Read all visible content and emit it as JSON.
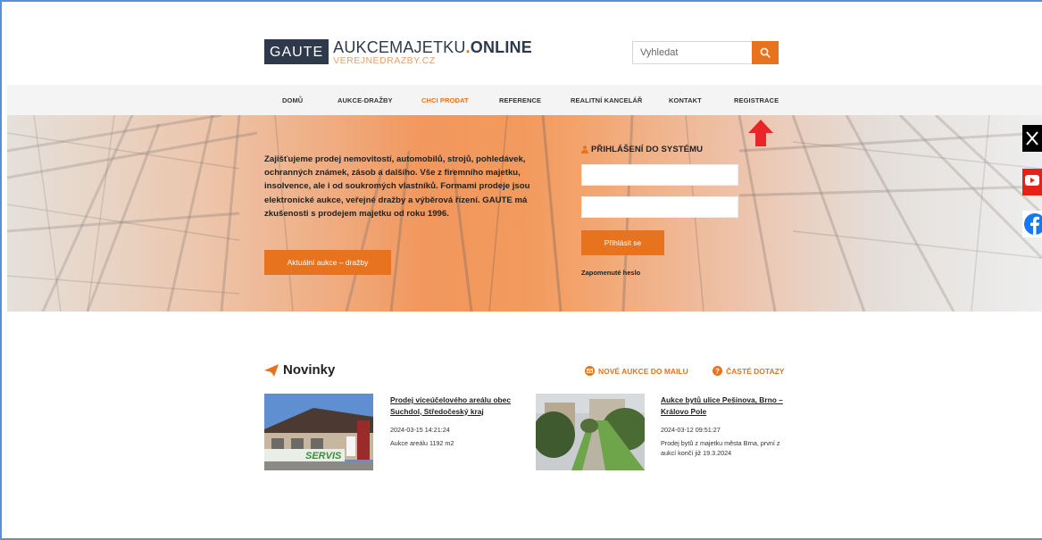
{
  "header": {
    "logo_box": "GAUTE",
    "logo_thin": "AUKCE",
    "logo_mid": "MAJETKU",
    "logo_dot": ".",
    "logo_bold": "ONLINE",
    "logo_sub": "VEREJNEDRAZBY.CZ",
    "search_placeholder": "Vyhledat"
  },
  "nav": {
    "items": [
      {
        "label": "DOMŮ"
      },
      {
        "label": "AUKCE-DRAŽBY"
      },
      {
        "label": "CHCI PRODAT"
      },
      {
        "label": "REFERENCE"
      },
      {
        "label": "REALITNÍ KANCELÁŘ"
      },
      {
        "label": "KONTAKT"
      },
      {
        "label": "REGISTRACE"
      }
    ],
    "active_color": "#e8731f"
  },
  "hero": {
    "text": "Zajišťujeme prodej nemovitostí, automobilů, strojů, pohledávek, ochranných známek, zásob a dalšího. Vše z firemního majetku, insolvence, ale i od soukromých vlastníků. Formami prodeje jsou elektronické aukce, veřejné dražby a výběrová řízení. GAUTE má zkušenosti s prodejem majetku od roku 1996.",
    "button": "Aktuální aukce – dražby"
  },
  "login": {
    "title": "PŘIHLÁŠENÍ DO SYSTÉMU",
    "button": "Přihlásit se",
    "forgot": "Zapomenuté heslo"
  },
  "news": {
    "title": "Novinky",
    "link_mail": "NOVÉ AUKCE DO MAILU",
    "link_faq": "ČASTÉ DOTAZY",
    "items": [
      {
        "title": "Prodej víceúčelového areálu obec Suchdol, Středočeský kraj",
        "date": "2024-03-15 14:21:24",
        "desc": "Aukce areálu 1192 m2",
        "img_text": "SERVIS"
      },
      {
        "title": "Aukce bytů ulice Pešinova, Brno – Královo Pole",
        "date": "2024-03-12 09:51:27",
        "desc": "Prodej bytů z majetku města Brna, první z aukcí končí již 19.3.2024"
      }
    ]
  },
  "colors": {
    "accent": "#e8731f",
    "dark": "#2e3a4b"
  }
}
